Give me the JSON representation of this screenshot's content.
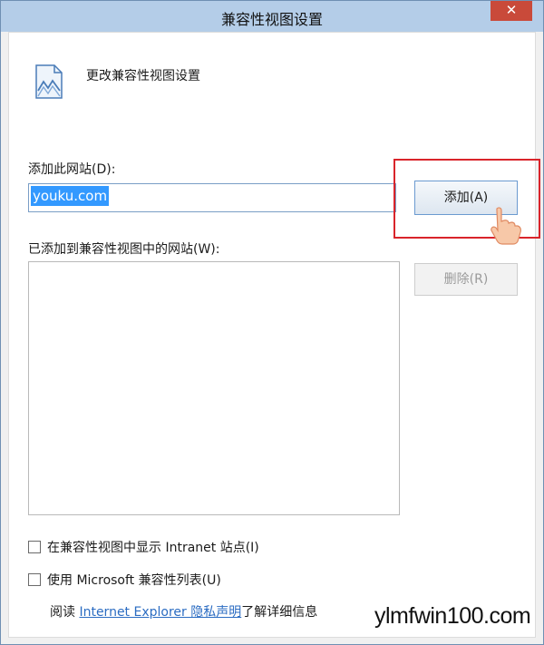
{
  "window": {
    "title": "兼容性视图设置",
    "close_glyph": "✕"
  },
  "header": {
    "icon": "compatibility-view-icon",
    "text": "更改兼容性视图设置"
  },
  "add_site": {
    "label": "添加此网站(D):",
    "input_value": "youku.com",
    "add_button_label": "添加(A)"
  },
  "site_list": {
    "label": "已添加到兼容性视图中的网站(W):",
    "items": [],
    "remove_button_label": "删除(R)"
  },
  "options": {
    "intranet_label": "在兼容性视图中显示 Intranet 站点(I)",
    "intranet_checked": false,
    "microsoft_list_label": "使用 Microsoft 兼容性列表(U)",
    "microsoft_list_checked": false
  },
  "footer": {
    "prefix": "阅读 ",
    "link": "Internet Explorer 隐私声明",
    "suffix": "了解详细信息"
  },
  "watermark": "ylmfwin100.com",
  "colors": {
    "highlight": "#d9242b",
    "selection": "#3399ff",
    "link": "#2b6cc2"
  }
}
